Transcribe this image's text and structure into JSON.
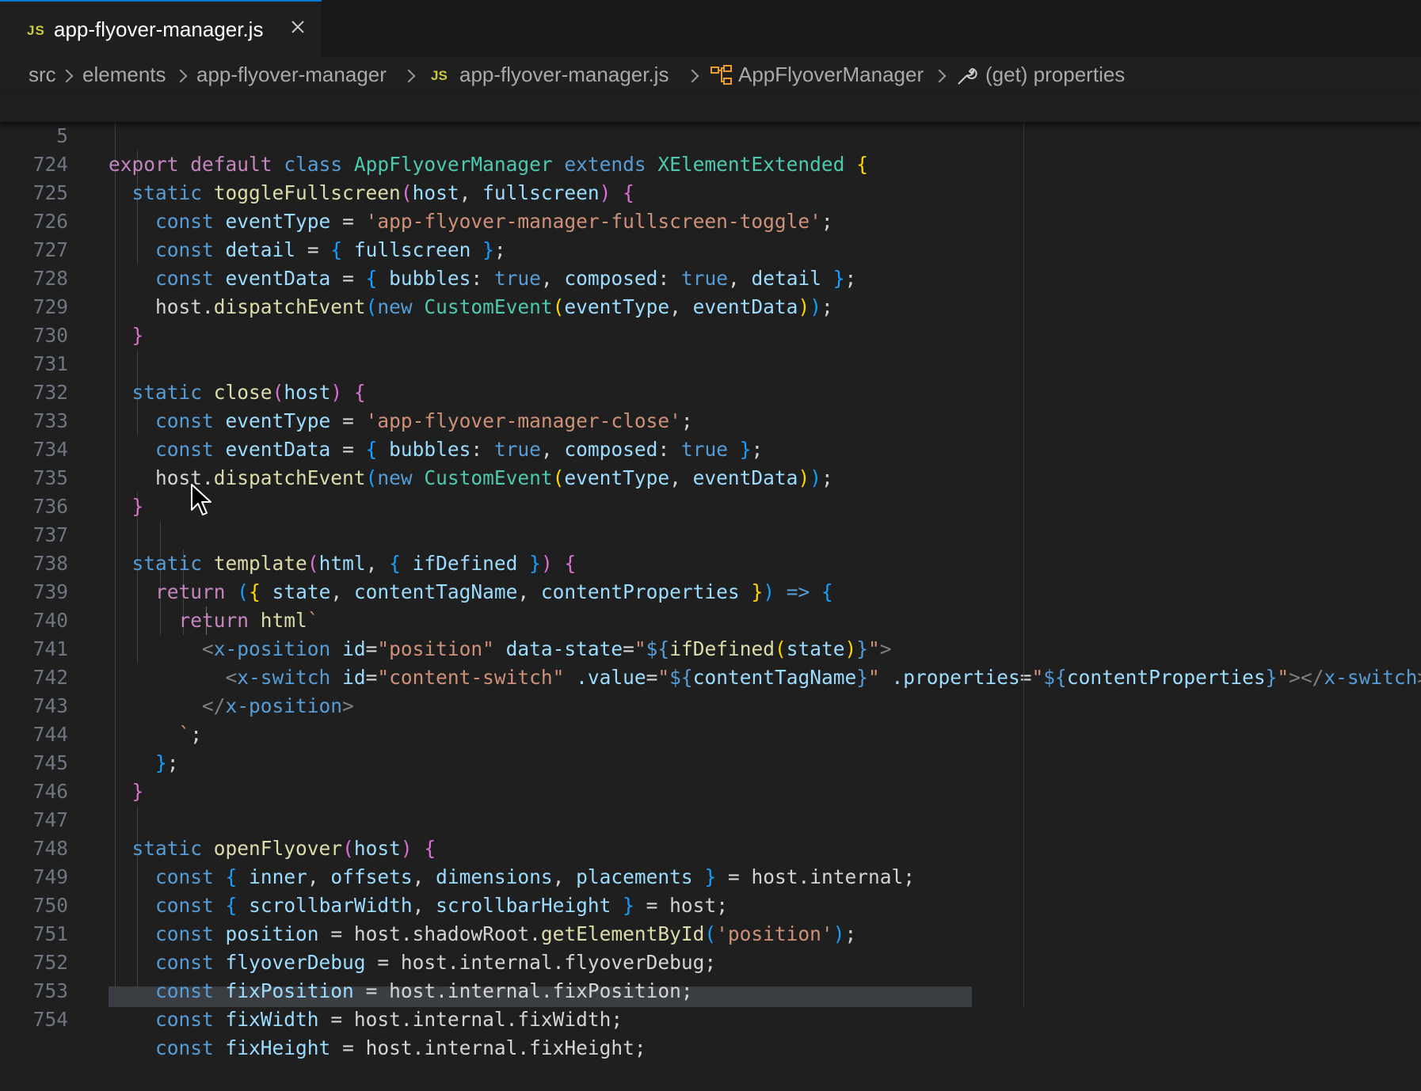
{
  "tab": {
    "icon": "JS",
    "label": "app-flyover-manager.js",
    "close_icon": "close-icon"
  },
  "breadcrumb": {
    "items": [
      "src",
      "elements",
      "app-flyover-manager",
      "app-flyover-manager.js",
      "AppFlyoverManager",
      "(get) properties"
    ],
    "js_icon": "JS"
  },
  "sticky": {
    "line_number": "5"
  },
  "editor": {
    "line_numbers": [
      "724",
      "725",
      "726",
      "727",
      "728",
      "729",
      "730",
      "731",
      "732",
      "733",
      "734",
      "735",
      "736",
      "737",
      "738",
      "739",
      "740",
      "741",
      "742",
      "743",
      "744",
      "745",
      "746",
      "747",
      "748",
      "749",
      "750",
      "751",
      "752",
      "753",
      "754"
    ]
  },
  "colors": {
    "background": "#1f1f1f",
    "keyword": "#569cd6",
    "control": "#c586c0",
    "class": "#4ec9b0",
    "function": "#dcdcaa",
    "variable": "#9cdcfe",
    "string": "#ce9178",
    "line_number": "#6e7681"
  }
}
